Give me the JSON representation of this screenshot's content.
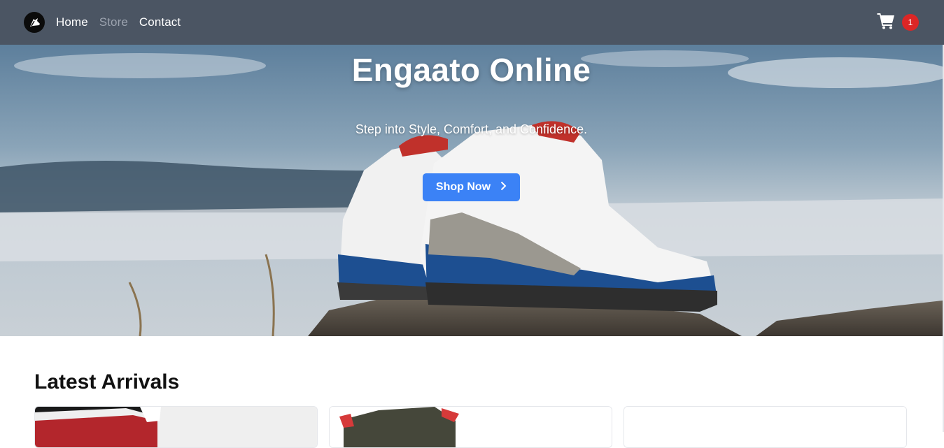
{
  "nav": {
    "logo_icon": "shoe-logo-icon",
    "links": [
      {
        "label": "Home",
        "active": false
      },
      {
        "label": "Store",
        "active": true
      },
      {
        "label": "Contact",
        "active": false
      }
    ],
    "cart_icon": "shopping-cart-icon",
    "cart_count": "1"
  },
  "hero": {
    "title": "Engaato Online",
    "subtitle": "Step into Style, Comfort, and Confidence.",
    "button_label": "Shop Now",
    "button_icon": "chevron-right-icon"
  },
  "latest": {
    "title": "Latest Arrivals",
    "cards": [
      {
        "image": "red-black-sneaker-image"
      },
      {
        "image": "olive-green-sneaker-image"
      },
      {
        "image": "blank-product-image"
      }
    ]
  },
  "colors": {
    "navbar": "#4b5563",
    "accent": "#3b82f6",
    "badge": "#dc2626"
  }
}
